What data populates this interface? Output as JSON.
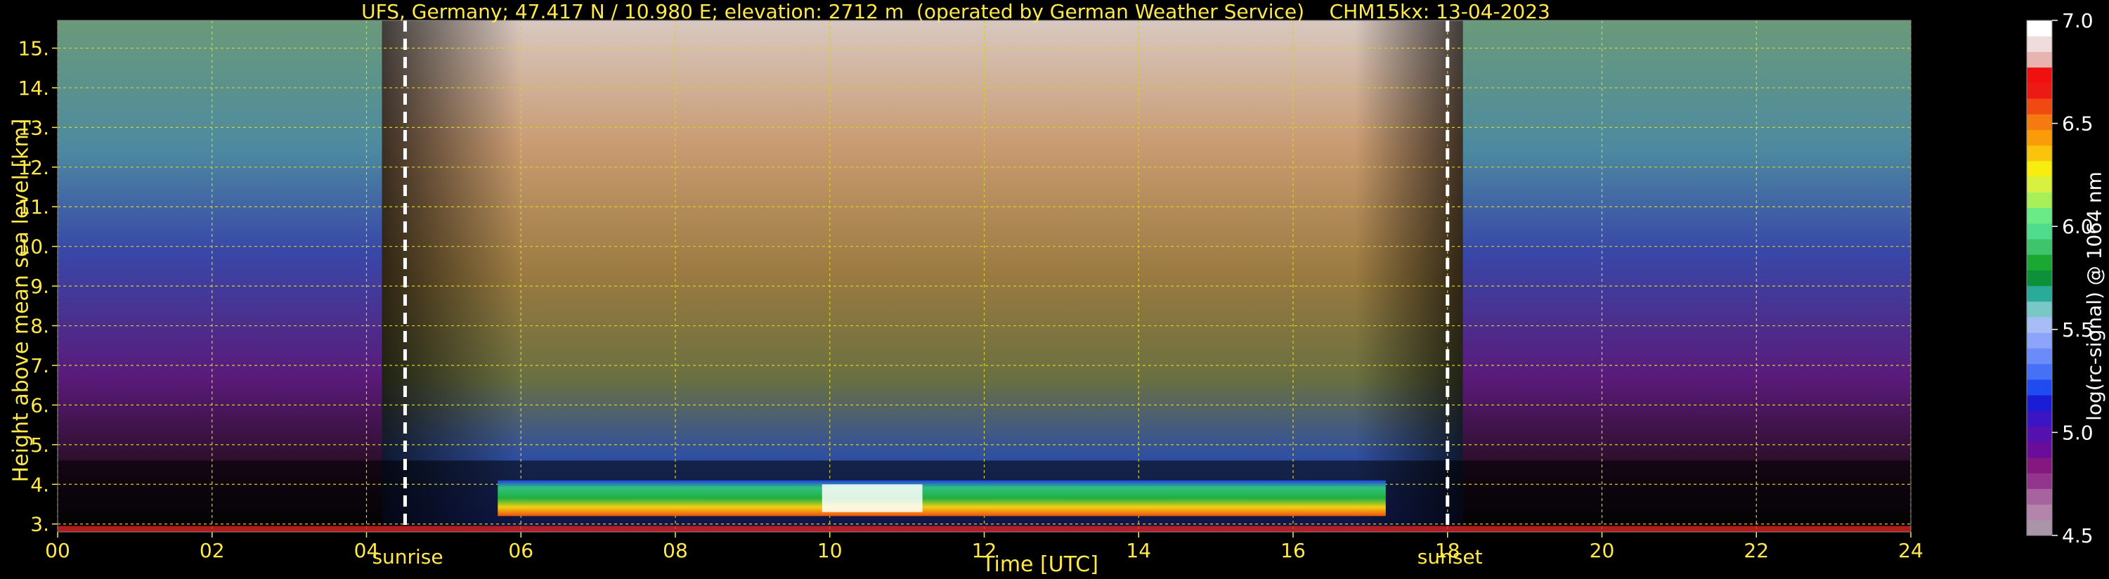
{
  "chart_data": {
    "type": "heatmap",
    "title": "UFS, Germany; 47.417 N / 10.980 E; elevation: 2712 m  (operated by German Weather Service)    CHM15kx: 13-04-2023",
    "xlabel": "Time [UTC]",
    "ylabel": "Height above mean sea level [km]",
    "xlim": [
      0,
      24
    ],
    "ylim": [
      2.8,
      15.7
    ],
    "x_ticks": [
      "00",
      "02",
      "04",
      "06",
      "08",
      "10",
      "12",
      "14",
      "16",
      "18",
      "20",
      "22",
      "24"
    ],
    "x_tick_values": [
      0,
      2,
      4,
      6,
      8,
      10,
      12,
      14,
      16,
      18,
      20,
      22,
      24
    ],
    "y_ticks": [
      "3.",
      "4.",
      "5.",
      "6.",
      "7.",
      "8.",
      "9.",
      "10.",
      "11.",
      "12.",
      "13.",
      "14.",
      "15."
    ],
    "y_tick_values": [
      3,
      4,
      5,
      6,
      7,
      8,
      9,
      10,
      11,
      12,
      13,
      14,
      15
    ],
    "grid": true,
    "markers": [
      {
        "label": "sunrise",
        "x": 4.5
      },
      {
        "label": "sunset",
        "x": 18.0
      }
    ],
    "colorbar": {
      "label": "log(rc-signal) @ 1064 nm",
      "ticks": [
        "4.5",
        "5.0",
        "5.5",
        "6.0",
        "6.5",
        "7.0"
      ],
      "tick_values": [
        4.5,
        5.0,
        5.5,
        6.0,
        6.5,
        7.0
      ],
      "range": [
        4.5,
        7.0
      ],
      "colors": [
        "#a995a7",
        "#b484ac",
        "#a6639e",
        "#93358c",
        "#85187f",
        "#6a0d9a",
        "#5411b0",
        "#3b14c4",
        "#1a1dd6",
        "#1f4bf0",
        "#4670f5",
        "#6a8bf8",
        "#8ca4fa",
        "#a8bcf5",
        "#79c7c7",
        "#2aaa99",
        "#0e8f3a",
        "#1aa832",
        "#3ec46a",
        "#4fdc8c",
        "#6aeb88",
        "#a8f05a",
        "#d8f040",
        "#f7ee10",
        "#fbc40c",
        "#fa9c0a",
        "#f57a10",
        "#f04a12",
        "#ec1a14",
        "#f01010",
        "#e8b4b0",
        "#f0dcdc",
        "#ffffff"
      ]
    },
    "cloud_layer_km": [
      3.2,
      4.1
    ],
    "cloud_layer_time_h": [
      5.7,
      17.2
    ]
  }
}
